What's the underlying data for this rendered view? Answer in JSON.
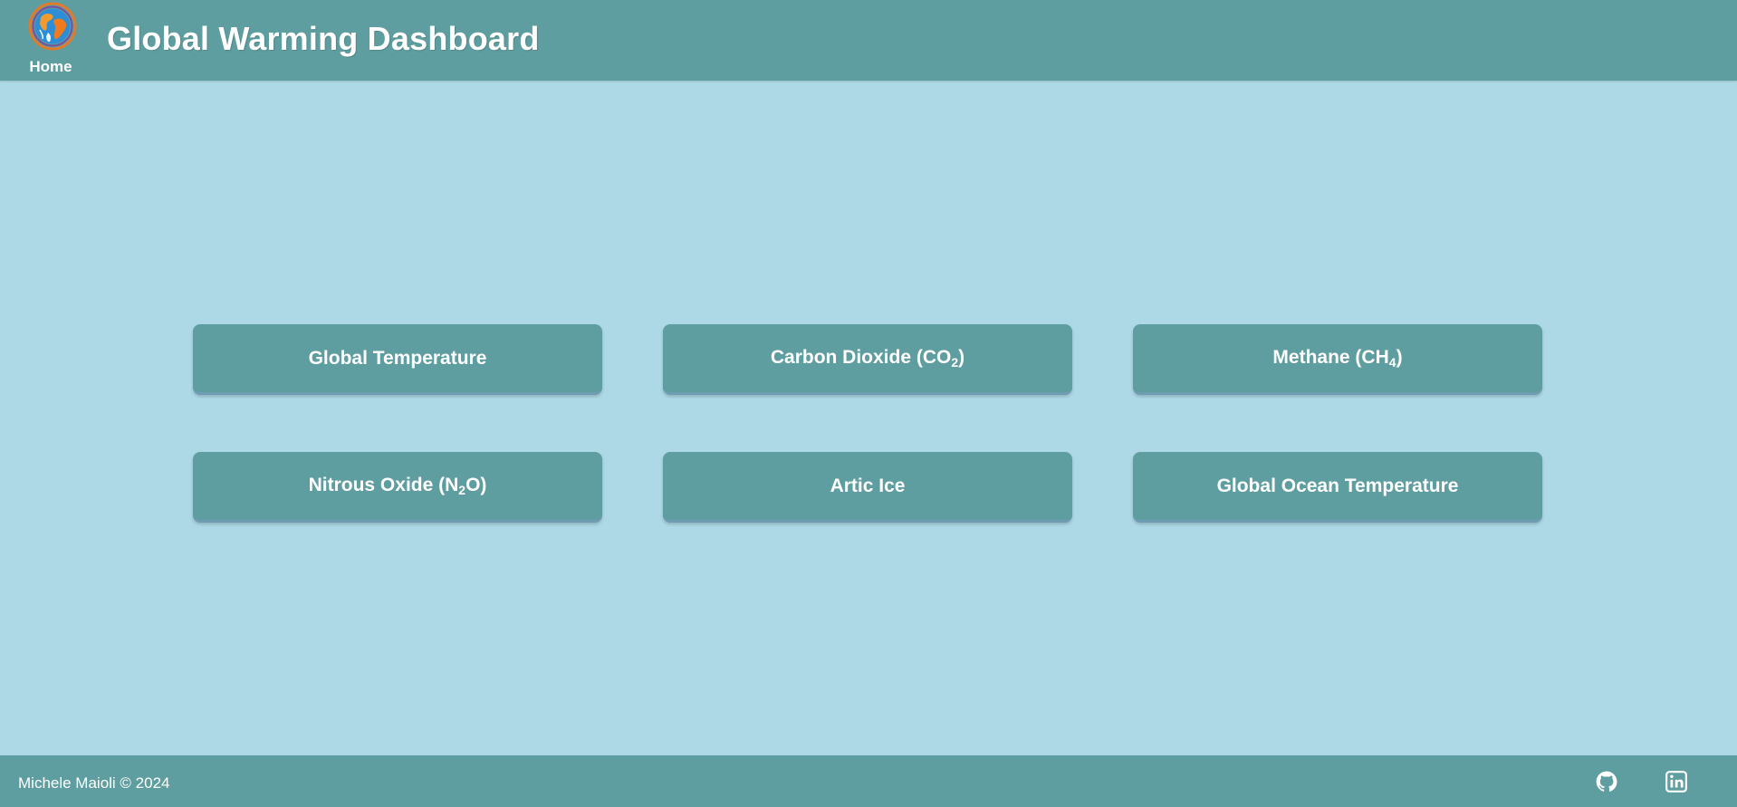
{
  "header": {
    "home_label": "Home",
    "title": "Global Warming Dashboard",
    "logo_icon": "globe-icon"
  },
  "nav_buttons": [
    {
      "label": "Global Temperature"
    },
    {
      "label_pre": "Carbon Dioxide (CO",
      "label_sub": "2",
      "label_post": ")"
    },
    {
      "label_pre": "Methane (CH",
      "label_sub": "4",
      "label_post": ")"
    },
    {
      "label_pre": "Nitrous Oxide (N",
      "label_sub": "2",
      "label_post": "O)"
    },
    {
      "label": "Artic Ice"
    },
    {
      "label": "Global Ocean Temperature"
    }
  ],
  "footer": {
    "copyright": "Michele Maioli © 2024",
    "github_icon": "github-icon",
    "linkedin_icon": "linkedin-icon"
  },
  "colors": {
    "background": "#add8e6",
    "bar": "#5f9ea0",
    "text": "#ffffff"
  }
}
